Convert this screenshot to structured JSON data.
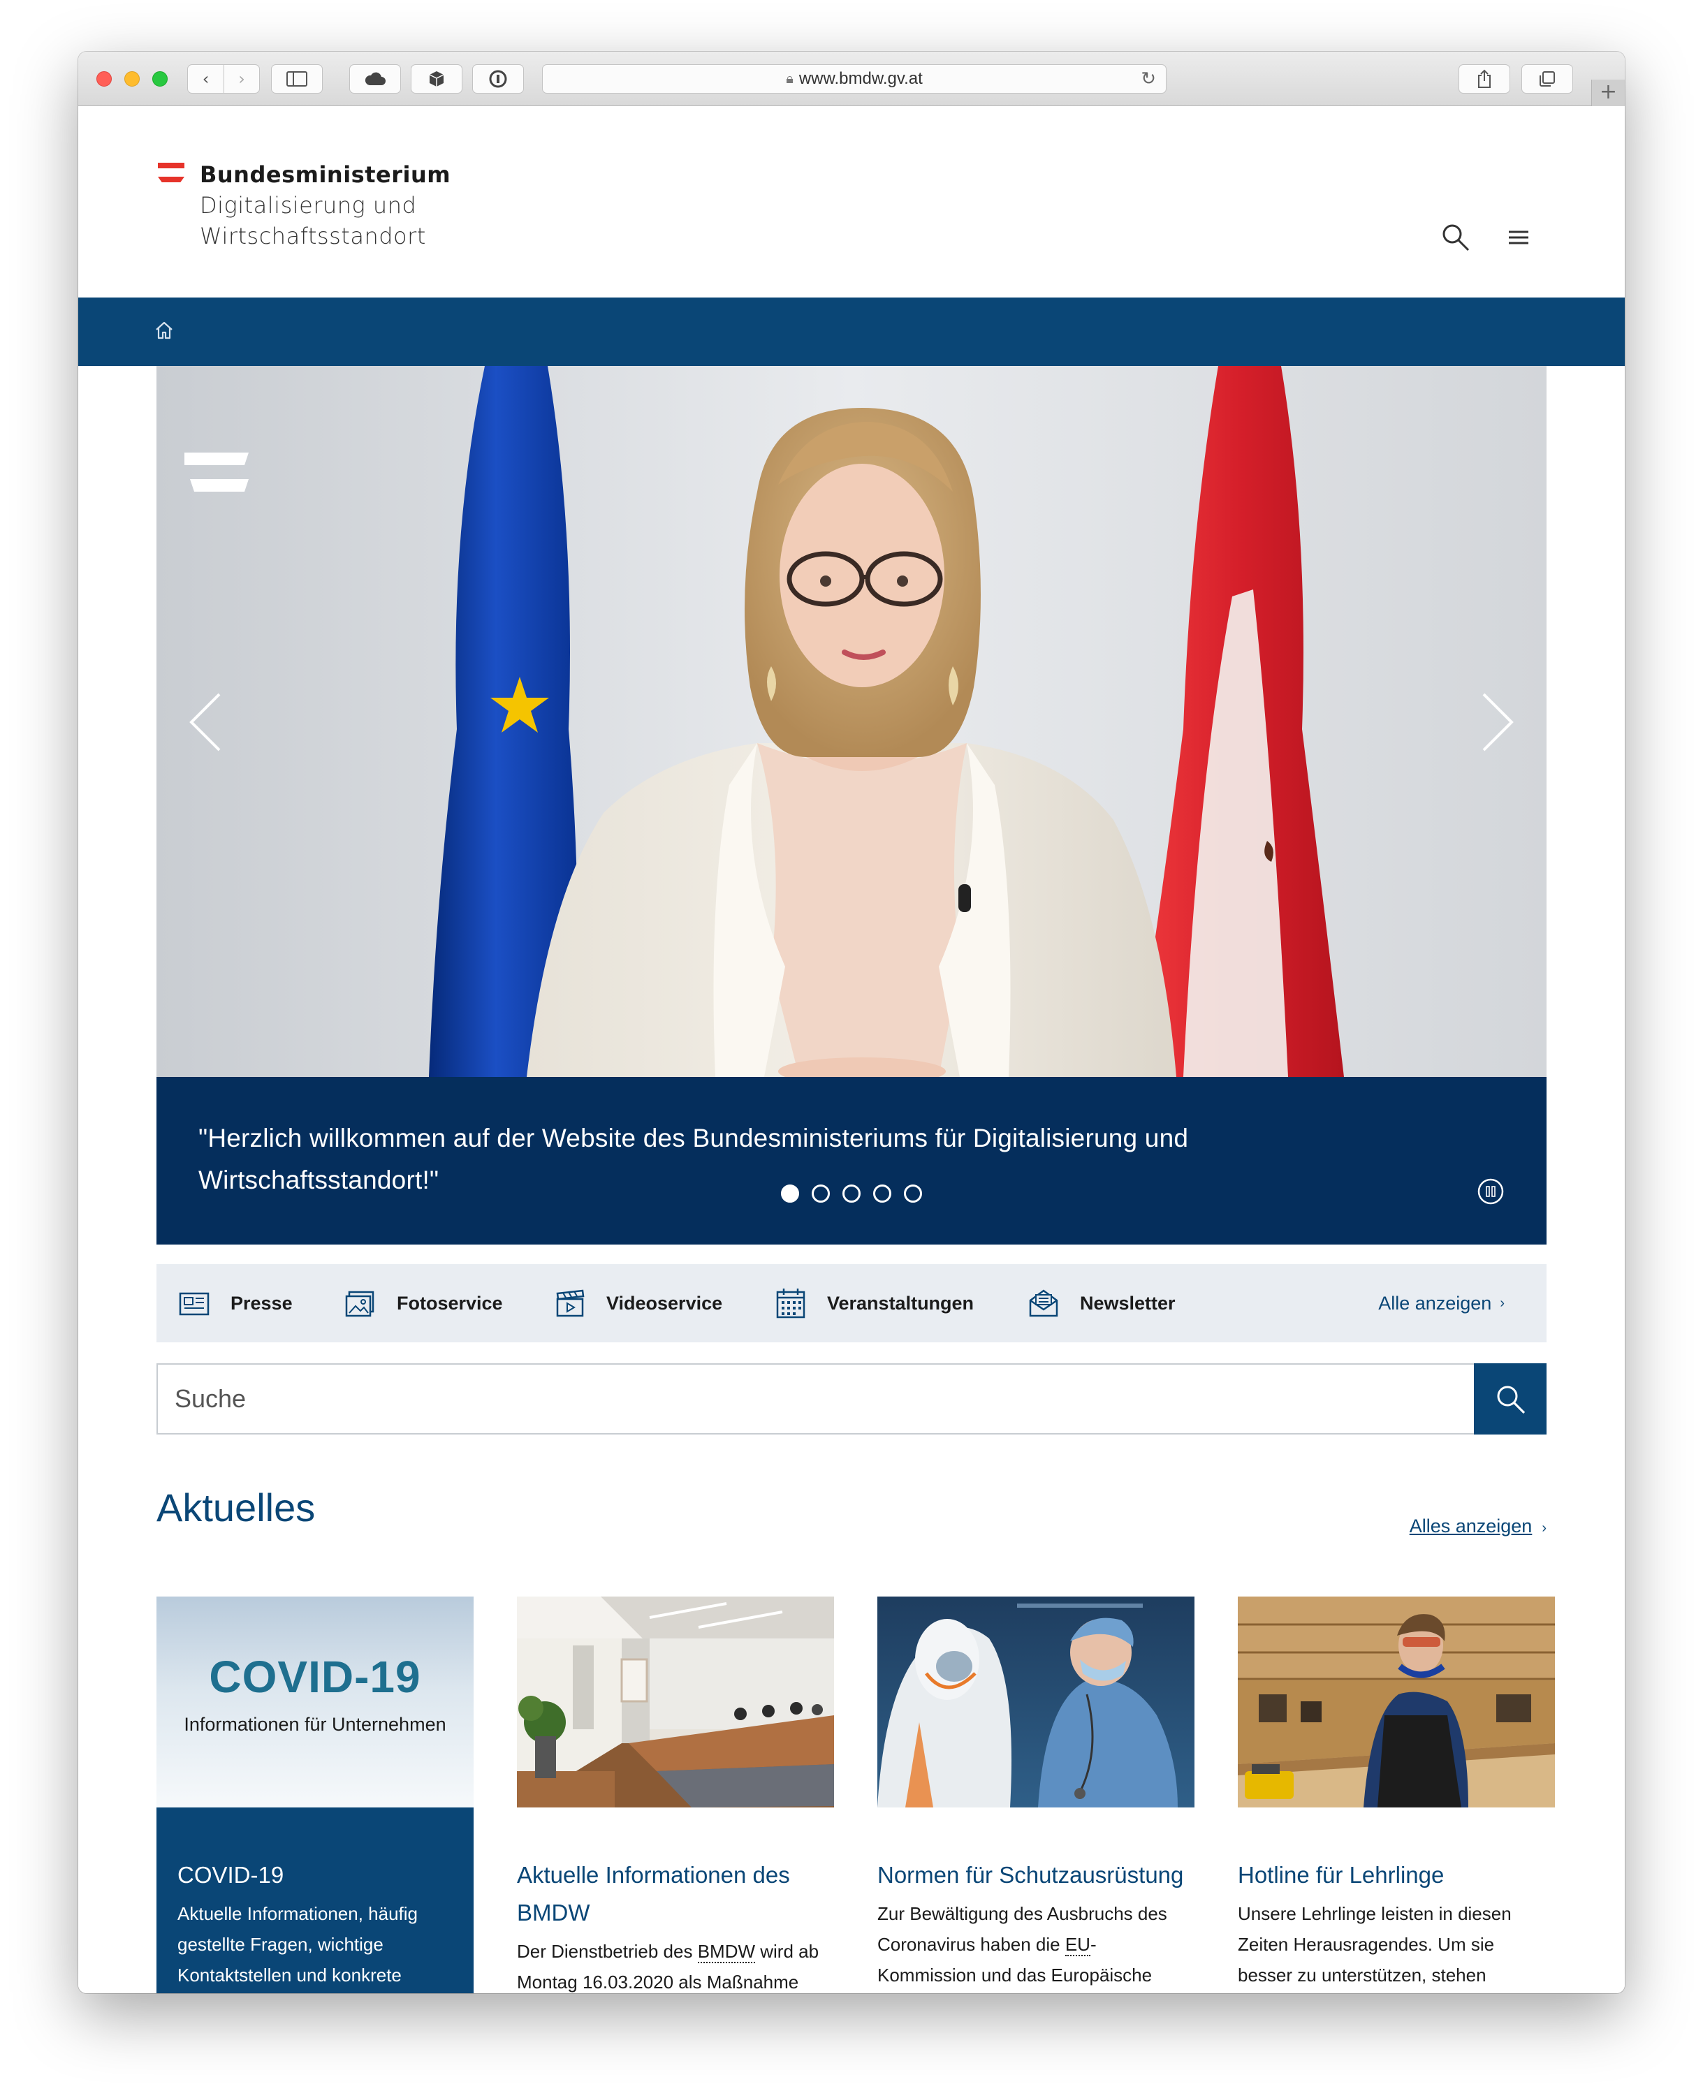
{
  "browser": {
    "url": "www.bmdw.gv.at",
    "nav_back": "‹",
    "nav_forward": "›",
    "new_tab": "+"
  },
  "header": {
    "logo_line1": "Bundesministerium",
    "logo_line2": "Digitalisierung und",
    "logo_line3": "Wirtschaftsstandort",
    "flag_colors": [
      "#e6332a",
      "#ffffff",
      "#e6332a"
    ]
  },
  "hero": {
    "quote": "\"Herzlich willkommen auf der Website des Bundesministeriums für Digitalisierung und Wirtschaftsstandort!\"",
    "slide_count": 5,
    "active_slide": 1,
    "colors": {
      "caption_bg": "#052e5c",
      "eu_flag": "#0b3aa8",
      "at_flag": "#e2202d"
    }
  },
  "services": {
    "items": [
      {
        "label": "Presse",
        "icon": "newspaper-icon"
      },
      {
        "label": "Fotoservice",
        "icon": "photo-icon"
      },
      {
        "label": "Videoservice",
        "icon": "clapperboard-icon"
      },
      {
        "label": "Veranstaltungen",
        "icon": "calendar-icon"
      },
      {
        "label": "Newsletter",
        "icon": "envelope-icon"
      }
    ],
    "all_label": "Alle anzeigen"
  },
  "search": {
    "placeholder": "Suche"
  },
  "news": {
    "title": "Aktuelles",
    "all_label": "Alles anzeigen",
    "cards": [
      {
        "image_title": "COVID-19",
        "image_subtitle": "Informationen für Unternehmen",
        "title": "COVID-19",
        "text": "Aktuelle Informationen, häufig gestellte Fragen, wichtige Kontaktstellen und konkrete"
      },
      {
        "title": "Aktuelle Informationen des BMDW",
        "text_before": "Der Dienstbetrieb des ",
        "text_abbr": "BMDW",
        "text_after": " wird ab Montag 16.03.2020 als Maßnahme"
      },
      {
        "title": "Normen für Schutzausrüstung",
        "text_before": "Zur Bewältigung des Ausbruchs des Coronavirus haben die ",
        "text_abbr": "EU",
        "text_after": "-Kommission und das Europäische"
      },
      {
        "title": "Hotline für Lehrlinge",
        "text": "Unsere Lehrlinge leisten in diesen Zeiten Herausragendes. Um sie besser zu unterstützen, stehen"
      }
    ]
  },
  "colors": {
    "primary": "#0a4676",
    "services_bg": "#e9edf2"
  }
}
